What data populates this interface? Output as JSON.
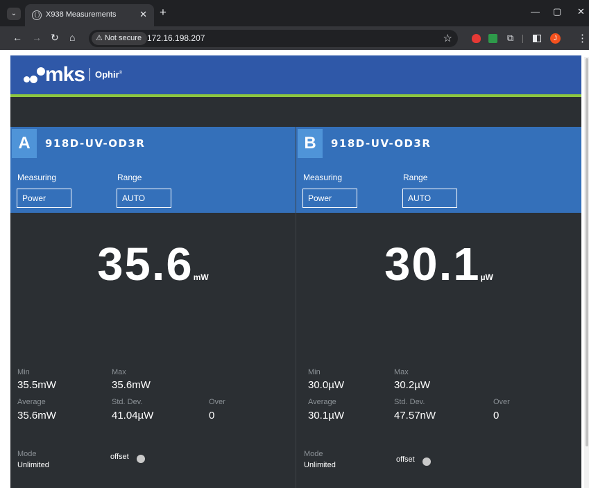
{
  "browser": {
    "tab_title": "X938 Measurements",
    "security_label": "Not secure",
    "url": "172.16.198.207",
    "profile_initial": "J"
  },
  "brand": {
    "logo_text": "mks",
    "sub_logo": "Ophir",
    "trademark": "®"
  },
  "channels": [
    {
      "letter": "A",
      "sensor": "918D-UV-OD3R",
      "measuring_label": "Measuring",
      "measuring_value": "Power",
      "range_label": "Range",
      "range_value": "AUTO",
      "reading": "35.6",
      "unit": "mW",
      "min_label": "Min",
      "min": "35.5mW",
      "max_label": "Max",
      "max": "35.6mW",
      "avg_label": "Average",
      "avg": "35.6mW",
      "std_label": "Std. Dev.",
      "std": "41.04µW",
      "over_label": "Over",
      "over": "0",
      "mode_label": "Mode",
      "mode": "Unlimited",
      "offset_label": "offset"
    },
    {
      "letter": "B",
      "sensor": "918D-UV-OD3R",
      "measuring_label": "Measuring",
      "measuring_value": "Power",
      "range_label": "Range",
      "range_value": "AUTO",
      "reading": "30.1",
      "unit": "µW",
      "min_label": "Min",
      "min": "30.0µW",
      "max_label": "Max",
      "max": "30.2µW",
      "avg_label": "Average",
      "avg": "30.1µW",
      "std_label": "Std. Dev.",
      "std": "47.57nW",
      "over_label": "Over",
      "over": "0",
      "mode_label": "Mode",
      "mode": "Unlimited",
      "offset_label": "offset"
    }
  ],
  "colors": {
    "brand_blue": "#2f58a8",
    "accent_green": "#8dc63f",
    "panel_header": "#3470ba",
    "panel_bg": "#2b2f33"
  }
}
